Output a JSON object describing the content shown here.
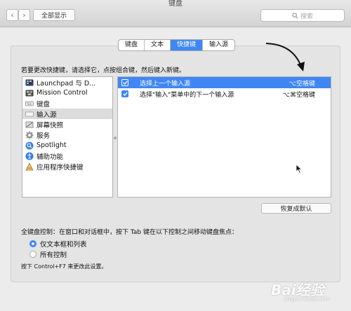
{
  "window": {
    "title": "键盘"
  },
  "toolbar": {
    "back_glyph": "‹",
    "forward_glyph": "›",
    "show_all": "全部显示",
    "search_placeholder": "搜索"
  },
  "tabs": [
    {
      "label": "键盘",
      "active": false
    },
    {
      "label": "文本",
      "active": false
    },
    {
      "label": "快捷键",
      "active": true
    },
    {
      "label": "输入源",
      "active": false
    }
  ],
  "instruction": "若要更改快捷键，请选择它，点按组合键，然后键入新键。",
  "categories": [
    {
      "label": "Launchpad 与 D...",
      "icon": "launchpad-icon"
    },
    {
      "label": "Mission Control",
      "icon": "mission-control-icon"
    },
    {
      "label": "键盘",
      "icon": "keyboard-icon"
    },
    {
      "label": "输入源",
      "icon": "input-source-icon",
      "selected": true
    },
    {
      "label": "屏幕快照",
      "icon": "screenshot-icon"
    },
    {
      "label": "服务",
      "icon": "services-gear-icon"
    },
    {
      "label": "Spotlight",
      "icon": "spotlight-icon"
    },
    {
      "label": "辅助功能",
      "icon": "accessibility-icon"
    },
    {
      "label": "应用程序快捷键",
      "icon": "app-shortcuts-icon"
    }
  ],
  "shortcuts": [
    {
      "label": "选择上一个输入源",
      "keys": "⌥空格键",
      "checked": true,
      "selected": true
    },
    {
      "label": "选择\"输入\"菜单中的下一个输入源",
      "keys": "⌥⌘空格键",
      "checked": true,
      "selected": false
    }
  ],
  "restore_button": "恢复成默认",
  "full_keyboard": {
    "label": "全键盘控制：在窗口和对话框中，按下 Tab 键在以下控制之间移动键盘焦点：",
    "options": [
      {
        "label": "仅文本框和列表",
        "selected": true
      },
      {
        "label": "所有控制",
        "selected": false
      }
    ],
    "hint": "按下 Control+F7 来更改此设置。"
  },
  "colors": {
    "accent": "#3f87f5"
  }
}
